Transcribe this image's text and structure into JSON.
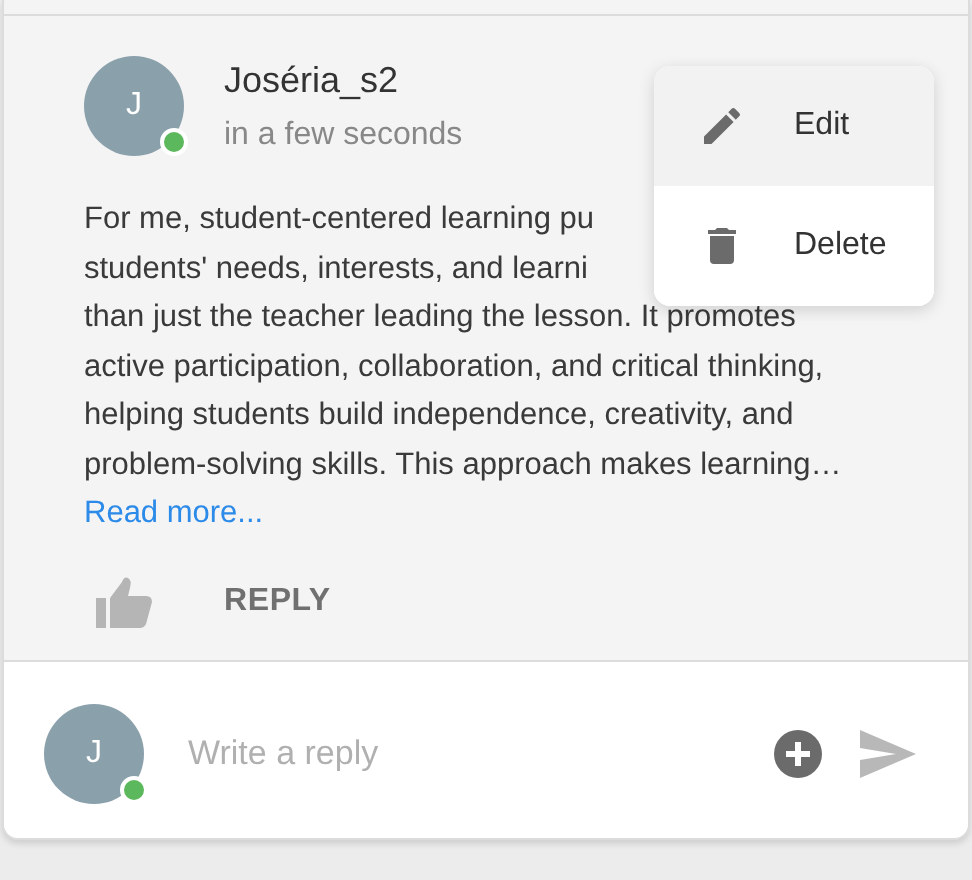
{
  "comment": {
    "avatar_initial": "J",
    "online": true,
    "author": "Joséria_s2",
    "time": "in a few seconds",
    "body_lines": [
      "For me, student-centered learning pu",
      "students' needs, interests, and learni",
      "than just the teacher leading the lesson. It promotes",
      "active participation, collaboration, and critical thinking,",
      "helping students build independence, creativity, and",
      "problem-solving skills. This approach makes learning…"
    ],
    "read_more": "Read more...",
    "reply_label": "REPLY"
  },
  "menu": [
    {
      "kind": "edit",
      "label": "Edit",
      "selected": true
    },
    {
      "kind": "delete",
      "label": "Delete",
      "selected": false
    }
  ],
  "reply_box": {
    "avatar_initial": "J",
    "online": true,
    "placeholder": "Write a reply"
  }
}
